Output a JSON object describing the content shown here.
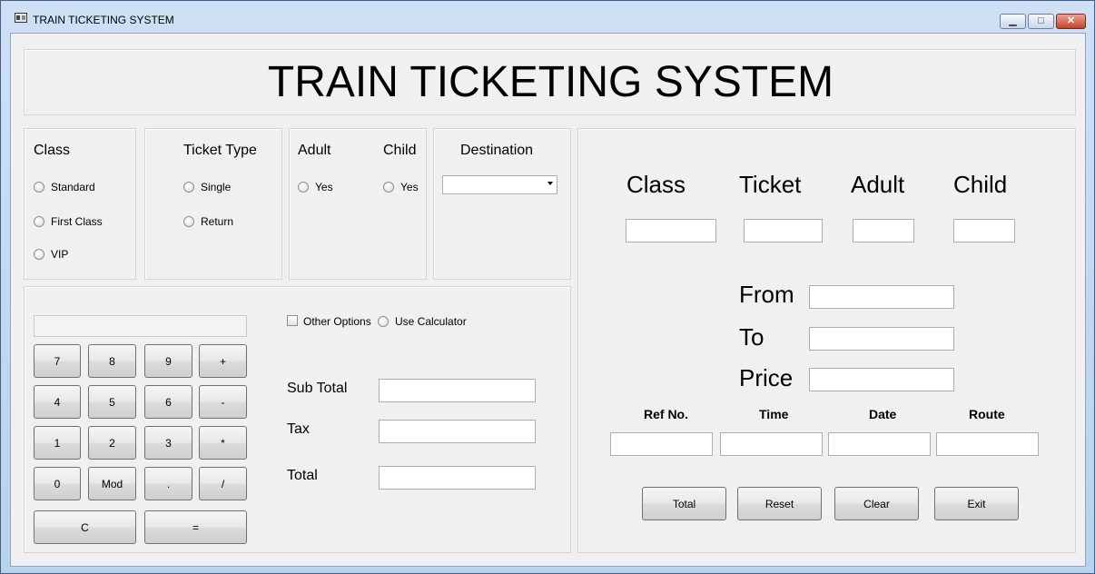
{
  "window": {
    "title": "TRAIN TICKETING SYSTEM",
    "controls": {
      "minimize": "▁",
      "maximize": "□",
      "close": "✕"
    }
  },
  "header": {
    "title": "TRAIN TICKETING SYSTEM"
  },
  "class_group": {
    "label": "Class",
    "options": [
      "Standard",
      "First Class",
      "VIP"
    ]
  },
  "ticket_type_group": {
    "label": "Ticket Type",
    "options": [
      "Single",
      "Return"
    ]
  },
  "passenger_group": {
    "adult_label": "Adult",
    "adult_option": "Yes",
    "child_label": "Child",
    "child_option": "Yes"
  },
  "destination_group": {
    "label": "Destination",
    "selected": ""
  },
  "calculator": {
    "display": "",
    "keys": [
      "7",
      "8",
      "9",
      "+",
      "4",
      "5",
      "6",
      "-",
      "1",
      "2",
      "3",
      "*",
      "0",
      "Mod",
      ".",
      "/"
    ],
    "clear_key": "C",
    "equals_key": "="
  },
  "options": {
    "other_options": "Other Options",
    "use_calculator": "Use Calculator"
  },
  "totals": {
    "sub_total_label": "Sub Total",
    "sub_total": "",
    "tax_label": "Tax",
    "tax": "",
    "total_label": "Total",
    "total": ""
  },
  "summary": {
    "headers": [
      "Class",
      "Ticket",
      "Adult",
      "Child"
    ],
    "values": [
      "",
      "",
      "",
      ""
    ],
    "from_label": "From",
    "from_value": "",
    "to_label": "To",
    "to_value": "",
    "price_label": "Price",
    "price_value": "",
    "detail_headers": [
      "Ref No.",
      "Time",
      "Date",
      "Route"
    ],
    "detail_values": [
      "",
      "",
      "",
      ""
    ]
  },
  "actions": {
    "total": "Total",
    "reset": "Reset",
    "clear": "Clear",
    "exit": "Exit"
  }
}
